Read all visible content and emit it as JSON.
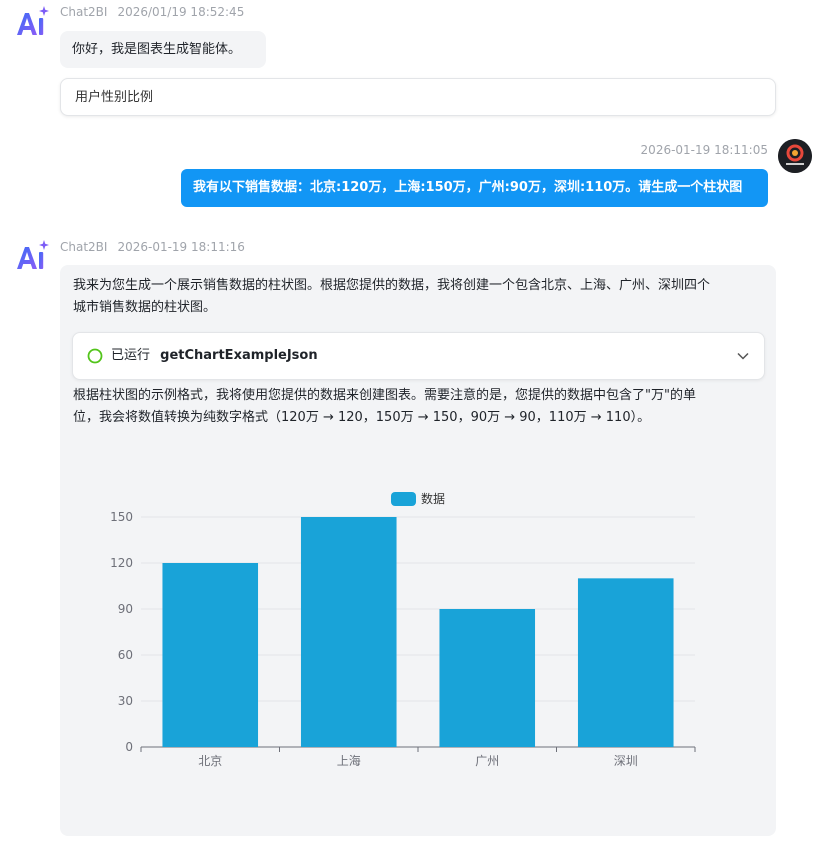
{
  "messages": [
    {
      "sender": "Chat2BI",
      "time": "2026/01/19 18:52:45",
      "text": "你好，我是图表生成智能体。",
      "suggestion": "用户性别比例"
    },
    {
      "time": "2026-01-19 18:11:05",
      "text": "我有以下销售数据：北京:120万，上海:150万，广州:90万，深圳:110万。请生成一个柱状图",
      "avatar_icon": "brand-avatar-icon"
    },
    {
      "sender": "Chat2BI",
      "time": "2026-01-19 18:11:16",
      "intro_line1": "我来为您生成一个展示销售数据的柱状图。根据您提供的数据，我将创建一个包含北京、上海、广州、深圳四个",
      "intro_line2": "城市销售数据的柱状图。",
      "tool_status": "已运行",
      "tool_name": "getChartExampleJson",
      "note_line1": "根据柱状图的示例格式，我将使用您提供的数据来创建图表。需要注意的是，您提供的数据中包含了\"万\"的单",
      "note_line2": "位，我会将数值转换为纯数字格式（120万 → 120，150万 → 150，90万 → 90，110万 → 110）。"
    }
  ],
  "colors": {
    "accent": "#1296f5",
    "bar": "#19a3d8",
    "success": "#52c41a"
  },
  "chart_data": {
    "type": "bar",
    "categories": [
      "北京",
      "上海",
      "广州",
      "深圳"
    ],
    "series": [
      {
        "name": "数据",
        "values": [
          120,
          150,
          90,
          110
        ]
      }
    ],
    "ylim": [
      0,
      150
    ],
    "yticks": [
      0,
      30,
      60,
      90,
      120,
      150
    ],
    "grid": true,
    "legend": "top-center"
  }
}
